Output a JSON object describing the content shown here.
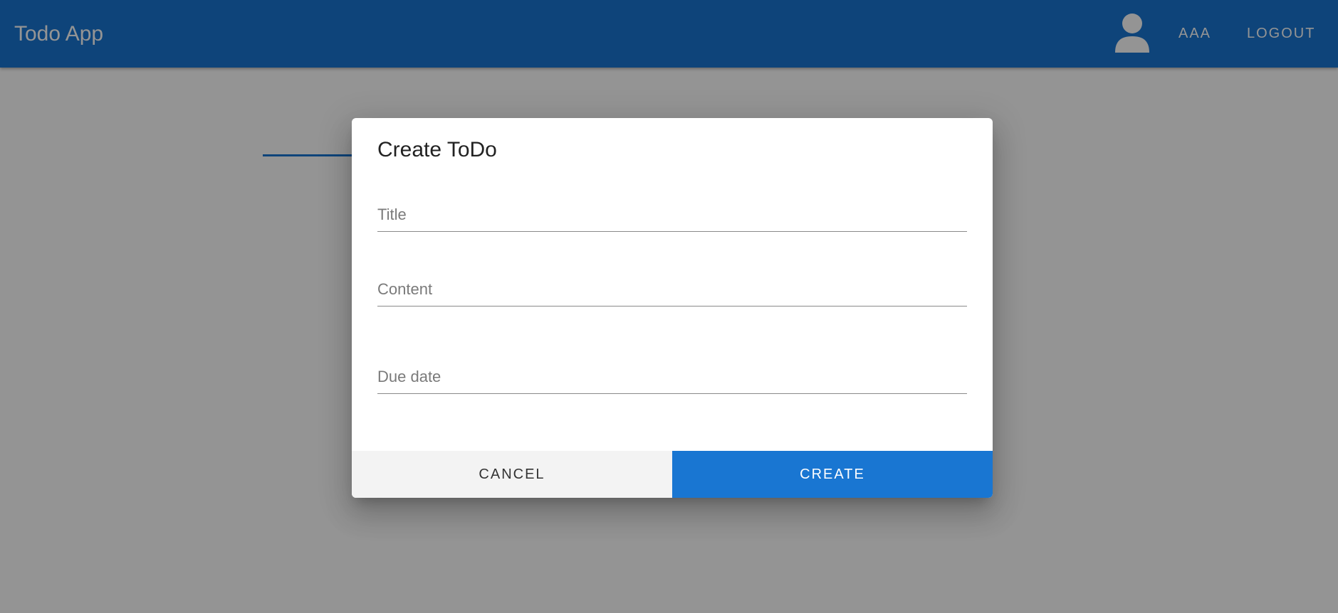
{
  "appbar": {
    "title": "Todo App",
    "avatar_icon": "person-icon",
    "user_label": "AAA",
    "logout_label": "LOGOUT"
  },
  "dialog": {
    "title": "Create ToDo",
    "fields": {
      "title_label": "Title",
      "content_label": "Content",
      "due_date_label": "Due date"
    },
    "actions": {
      "cancel_label": "CANCEL",
      "create_label": "CREATE"
    }
  },
  "colors": {
    "primary": "#1976d2",
    "backdrop": "rgba(0,0,0,0.42)"
  }
}
